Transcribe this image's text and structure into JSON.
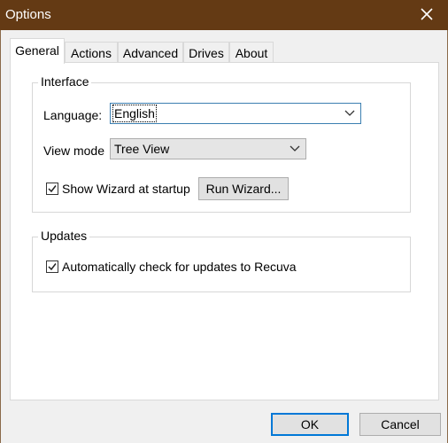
{
  "window": {
    "title": "Options"
  },
  "tabs": [
    "General",
    "Actions",
    "Advanced",
    "Drives",
    "About"
  ],
  "interface": {
    "legend": "Interface",
    "language_label": "Language:",
    "language_value": "English",
    "viewmode_label": "View mode",
    "viewmode_value": "Tree View",
    "show_wizard_label": "Show Wizard at startup",
    "show_wizard_checked": true,
    "run_wizard_button": "Run Wizard..."
  },
  "updates": {
    "legend": "Updates",
    "auto_check_label": "Automatically check for updates to Recuva",
    "auto_check_checked": true
  },
  "footer": {
    "ok": "OK",
    "cancel": "Cancel"
  },
  "icons": {
    "close": "close-icon",
    "dropdown": "chevron-down-icon",
    "check": "check-icon"
  },
  "colors": {
    "titlebar": "#643a14",
    "focus": "#3c7fb1",
    "default_button": "#0078d7"
  }
}
